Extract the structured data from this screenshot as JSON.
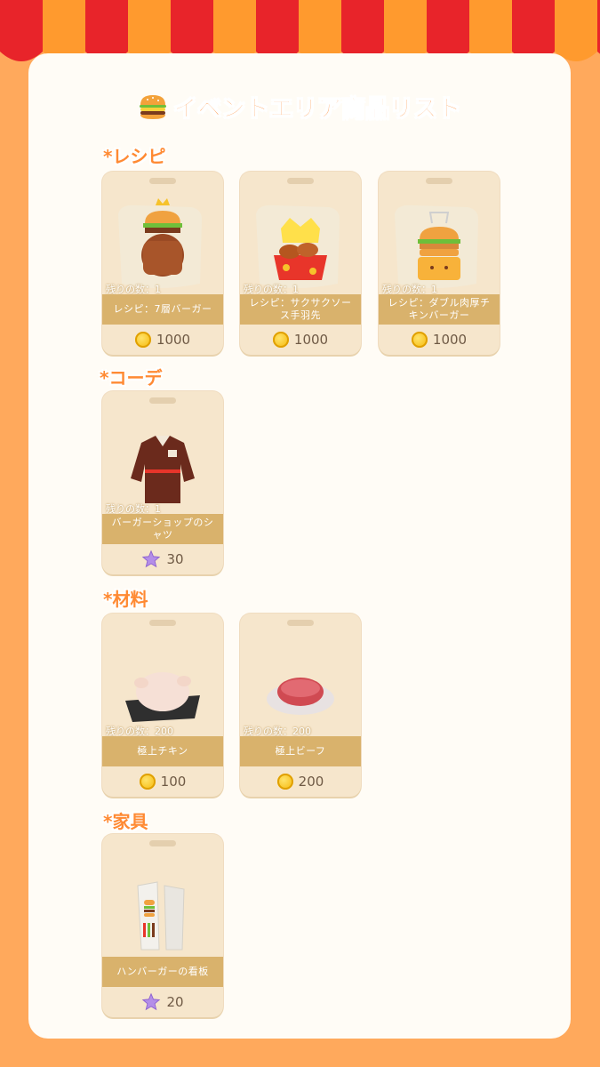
{
  "colors": {
    "background": "#ffa95c",
    "panel": "#fffcf6",
    "accent": "#ff8a33",
    "namebar": "#d9b26c",
    "awning_red": "#e8242a",
    "awning_orange": "#ff9a2e"
  },
  "title": {
    "icon": "burger-icon",
    "text": "イベントエリア商品リスト"
  },
  "sections": [
    {
      "label": "*レシピ",
      "items": [
        {
          "remaining": "残りの数：1",
          "name": "レシピ：7層バーガー",
          "currency_icon": "coin-icon",
          "price": "1000"
        },
        {
          "remaining": "残りの数：1",
          "name": "レシピ：サクサクソース手羽先",
          "currency_icon": "coin-icon",
          "price": "1000"
        },
        {
          "remaining": "残りの数：1",
          "name": "レシピ：ダブル肉厚チキンバーガー",
          "currency_icon": "coin-icon",
          "price": "1000"
        }
      ]
    },
    {
      "label": "*コーデ",
      "items": [
        {
          "remaining": "残りの数：1",
          "name": "バーガーショップのシャツ",
          "currency_icon": "star-icon",
          "price": "30"
        }
      ]
    },
    {
      "label": "*材料",
      "items": [
        {
          "remaining": "残りの数：200",
          "name": "極上チキン",
          "currency_icon": "coin-icon",
          "price": "100"
        },
        {
          "remaining": "残りの数：200",
          "name": "極上ビーフ",
          "currency_icon": "coin-icon",
          "price": "200"
        }
      ]
    },
    {
      "label": "*家具",
      "items": [
        {
          "remaining": "",
          "name": "ハンバーガーの看板",
          "currency_icon": "star-icon",
          "price": "20"
        }
      ]
    }
  ]
}
